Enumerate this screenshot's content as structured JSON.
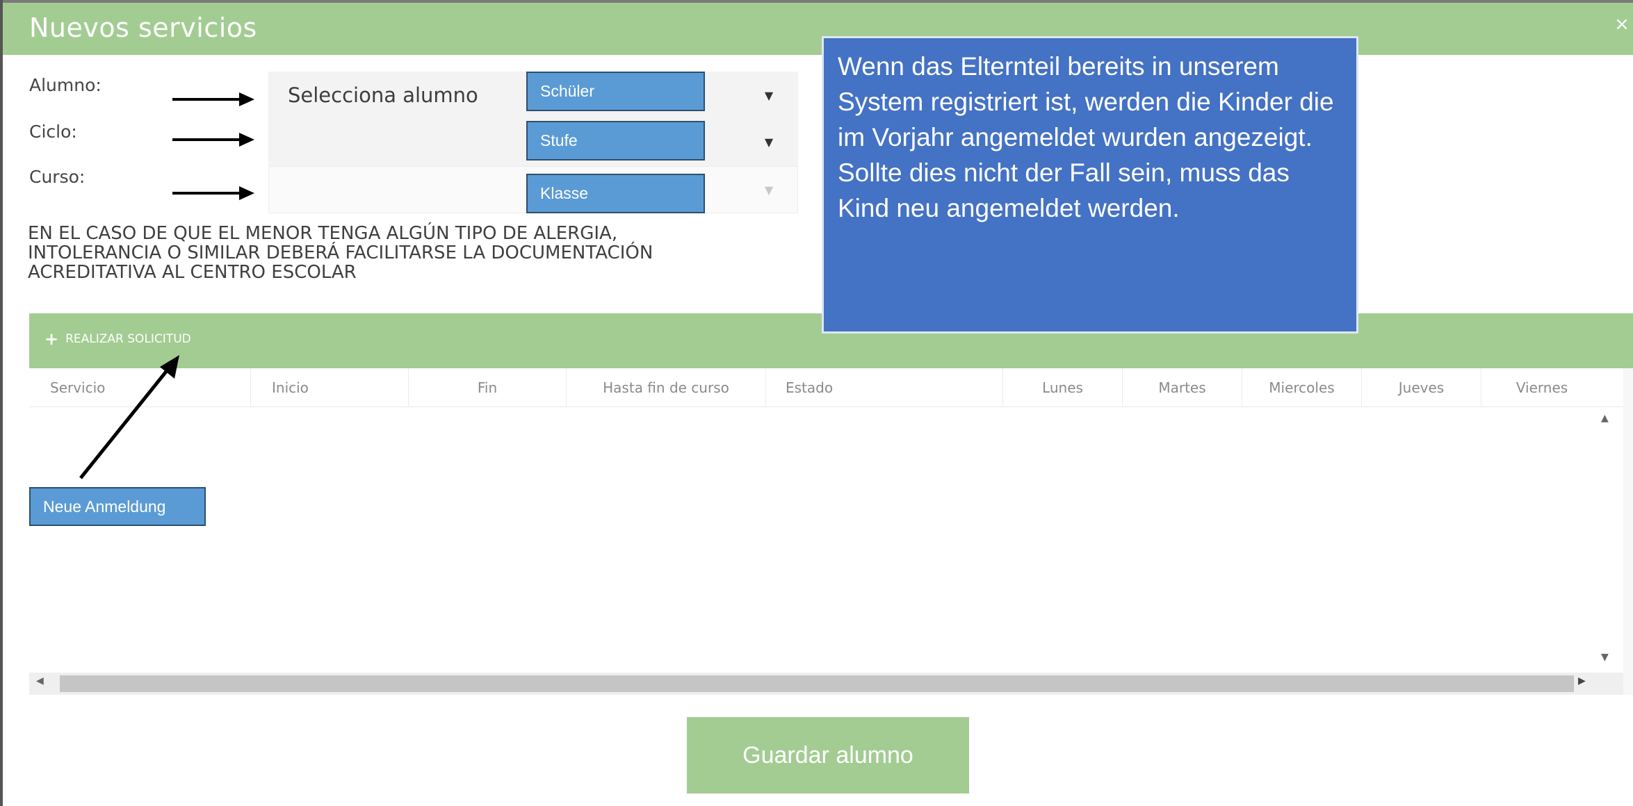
{
  "dialog": {
    "title": "Nuevos servicios",
    "close_glyph": "×"
  },
  "form": {
    "fields": [
      {
        "label": "Alumno:",
        "select_value": "Selecciona alumno",
        "annotation": "Schüler",
        "enabled": true
      },
      {
        "label": "Ciclo:",
        "select_value": "",
        "annotation": "Stufe",
        "enabled": true
      },
      {
        "label": "Curso:",
        "select_value": "",
        "annotation": "Klasse",
        "enabled": false
      }
    ],
    "caret_glyph": "▼"
  },
  "notice": "EN EL CASO DE QUE EL MENOR TENGA ALGÚN TIPO DE ALERGIA,\nINTOLERANCIA O SIMILAR DEBERÁ FACILITARSE LA DOCUMENTACIÓN\nACREDITATIVA AL CENTRO ESCOLAR",
  "callout": "Wenn das Elternteil bereits in unserem System registriert ist, werden die Kinder die im Vorjahr angemeldet wurden angezeigt. Sollte dies nicht der Fall sein, muss das Kind neu angemeldet werden.",
  "grid": {
    "add_button_plus": "+",
    "add_button_label": "REALIZAR SOLICITUD",
    "columns": [
      "Servicio",
      "Inicio",
      "Fin",
      "Hasta fin de curso",
      "Estado",
      "Lunes",
      "Martes",
      "Miercoles",
      "Jueves",
      "Viernes"
    ],
    "rows": [],
    "scroll_up": "▲",
    "scroll_down": "▼",
    "scroll_left": "◀",
    "scroll_right": "▶"
  },
  "annotation_new": "Neue Anmeldung",
  "save_button": "Guardar alumno",
  "colors": {
    "header_green": "#a3cc93",
    "annotation_blue": "#5b9bd5",
    "callout_blue": "#4472c4"
  },
  "icons": [
    "close-icon",
    "chevron-down-icon",
    "plus-icon",
    "arrow-right-icon",
    "arrow-diagonal-icon",
    "scroll-up-icon",
    "scroll-down-icon",
    "scroll-left-icon",
    "scroll-right-icon"
  ]
}
